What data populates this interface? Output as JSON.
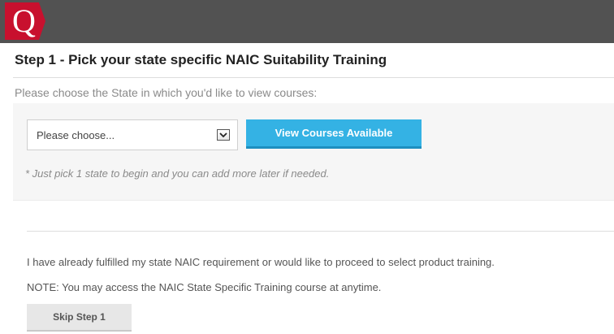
{
  "header": {
    "logo_letter": "Q",
    "brand_color": "#c8102e",
    "bar_color": "#525252"
  },
  "step": {
    "title": "Step 1 - Pick your state specific NAIC Suitability Training",
    "instruction": "Please choose the State in which you'd like to view courses:"
  },
  "state_form": {
    "select_value": "Please choose...",
    "view_button_label": "View Courses Available",
    "note": "* Just pick 1 state to begin and you can add more later if needed.",
    "button_color": "#34b2e4"
  },
  "skip_section": {
    "fulfilled_text": "I have already fulfilled my state NAIC requirement or would like to proceed to select product training.",
    "note_text": "NOTE: You may access the NAIC State Specific Training course at anytime.",
    "skip_button_label": "Skip Step 1"
  },
  "icons": {
    "logo": "q-logo-icon",
    "dropdown": "chevron-down-icon"
  }
}
